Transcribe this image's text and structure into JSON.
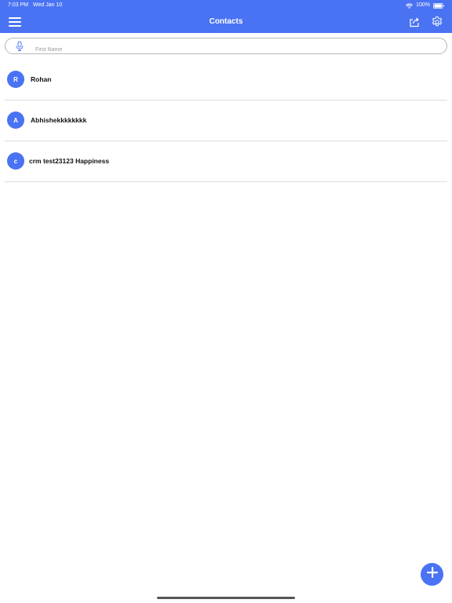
{
  "status_bar": {
    "time": "7:03 PM",
    "date": "Wed Jan 10",
    "battery": "100%",
    "icons": [
      "wifi-icon",
      "battery-icon"
    ]
  },
  "nav": {
    "title": "Contacts",
    "icons": [
      "hamburger-menu-icon",
      "share-icon",
      "gear-icon"
    ]
  },
  "search": {
    "placeholder": "First Name",
    "value": "",
    "icon": "microphone-icon"
  },
  "contacts": [
    {
      "initial": "R",
      "name": "Rohan"
    },
    {
      "initial": "A",
      "name": "Abhishekkkkkkkk"
    },
    {
      "initial": "c",
      "name": "crm test23123 Happiness"
    }
  ],
  "fab": {
    "icon": "plus-icon"
  },
  "colors": {
    "accent": "#4a73f3",
    "divider": "#dcdcdc",
    "text": "#111111"
  }
}
